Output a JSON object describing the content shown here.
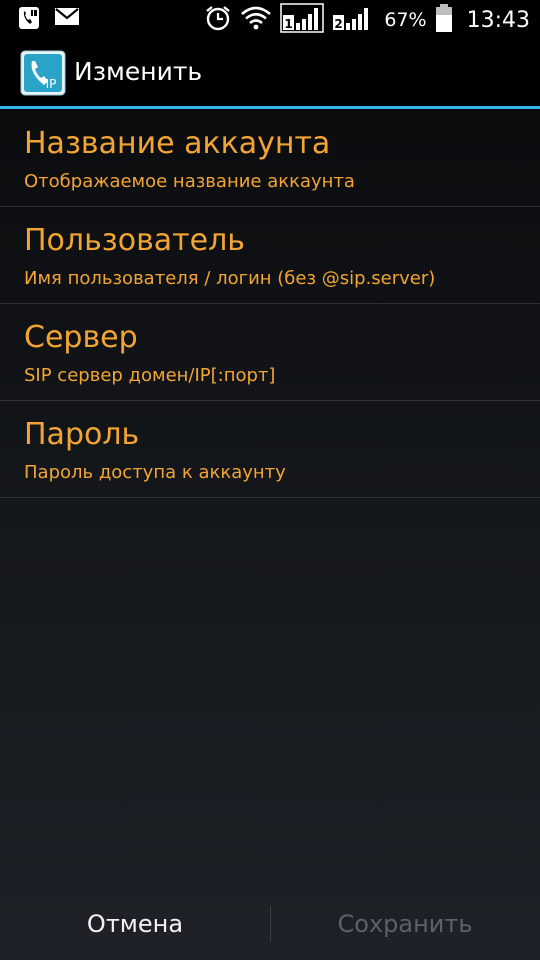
{
  "status_bar": {
    "icons": [
      "phone-ip-notification-icon",
      "mail-icon",
      "alarm-icon",
      "wifi-icon",
      "sim1-signal-icon",
      "sim2-signal-icon",
      "battery-icon"
    ],
    "sim1_label": "1",
    "sim2_label": "2",
    "battery_percent": "67%",
    "time": "13:43"
  },
  "action_bar": {
    "logo_icon": "ip-phone-app-icon",
    "logo_text": "IP",
    "title": "Изменить",
    "accent_color": "#33b5e5"
  },
  "preferences": [
    {
      "title": "Название аккаунта",
      "summary": "Отображаемое название аккаунта"
    },
    {
      "title": "Пользователь",
      "summary": "Имя пользователя / логин (без @sip.server)"
    },
    {
      "title": "Сервер",
      "summary": "SIP сервер домен/IP[:порт]"
    },
    {
      "title": "Пароль",
      "summary": "Пароль доступа к аккаунту"
    }
  ],
  "buttons": {
    "cancel_label": "Отмена",
    "save_label": "Сохранить",
    "save_enabled": false
  },
  "colors": {
    "text_orange": "#f3a534",
    "save_disabled": "#5d6064"
  }
}
